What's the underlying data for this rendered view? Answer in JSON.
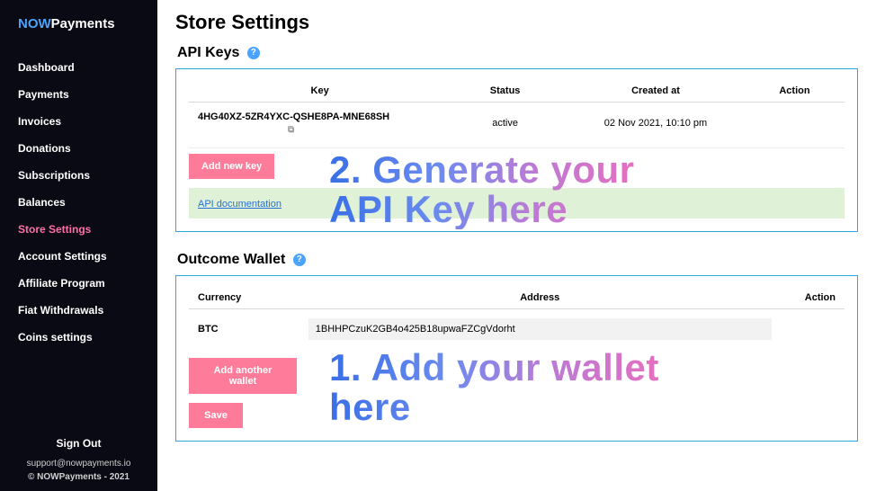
{
  "brand": {
    "now": "NOW",
    "pay": "Payments"
  },
  "nav": {
    "items": [
      "Dashboard",
      "Payments",
      "Invoices",
      "Donations",
      "Subscriptions",
      "Balances",
      "Store Settings",
      "Account Settings",
      "Affiliate Program",
      "Fiat Withdrawals",
      "Coins settings"
    ],
    "active_index": 6
  },
  "footer": {
    "signout": "Sign Out",
    "support": "support@nowpayments.io",
    "copyright": "© NOWPayments - 2021"
  },
  "page": {
    "title": "Store Settings"
  },
  "api_keys": {
    "title": "API Keys",
    "columns": {
      "key": "Key",
      "status": "Status",
      "created": "Created at",
      "action": "Action"
    },
    "rows": [
      {
        "key": "4HG40XZ-5ZR4YXC-QSHE8PA-MNE68SH",
        "status": "active",
        "created": "02 Nov 2021, 10:10 pm"
      }
    ],
    "add_btn": "Add new key",
    "doc_link": "API documentation",
    "overlay": "2. Generate your\nAPI Key here"
  },
  "outcome_wallet": {
    "title": "Outcome Wallet",
    "columns": {
      "currency": "Currency",
      "address": "Address",
      "action": "Action"
    },
    "rows": [
      {
        "currency": "BTC",
        "address": "1BHHPCzuK2GB4o425B18upwaFZCgVdorht"
      }
    ],
    "add_btn": "Add another wallet",
    "save_btn": "Save",
    "overlay": "1. Add your wallet\nhere"
  }
}
